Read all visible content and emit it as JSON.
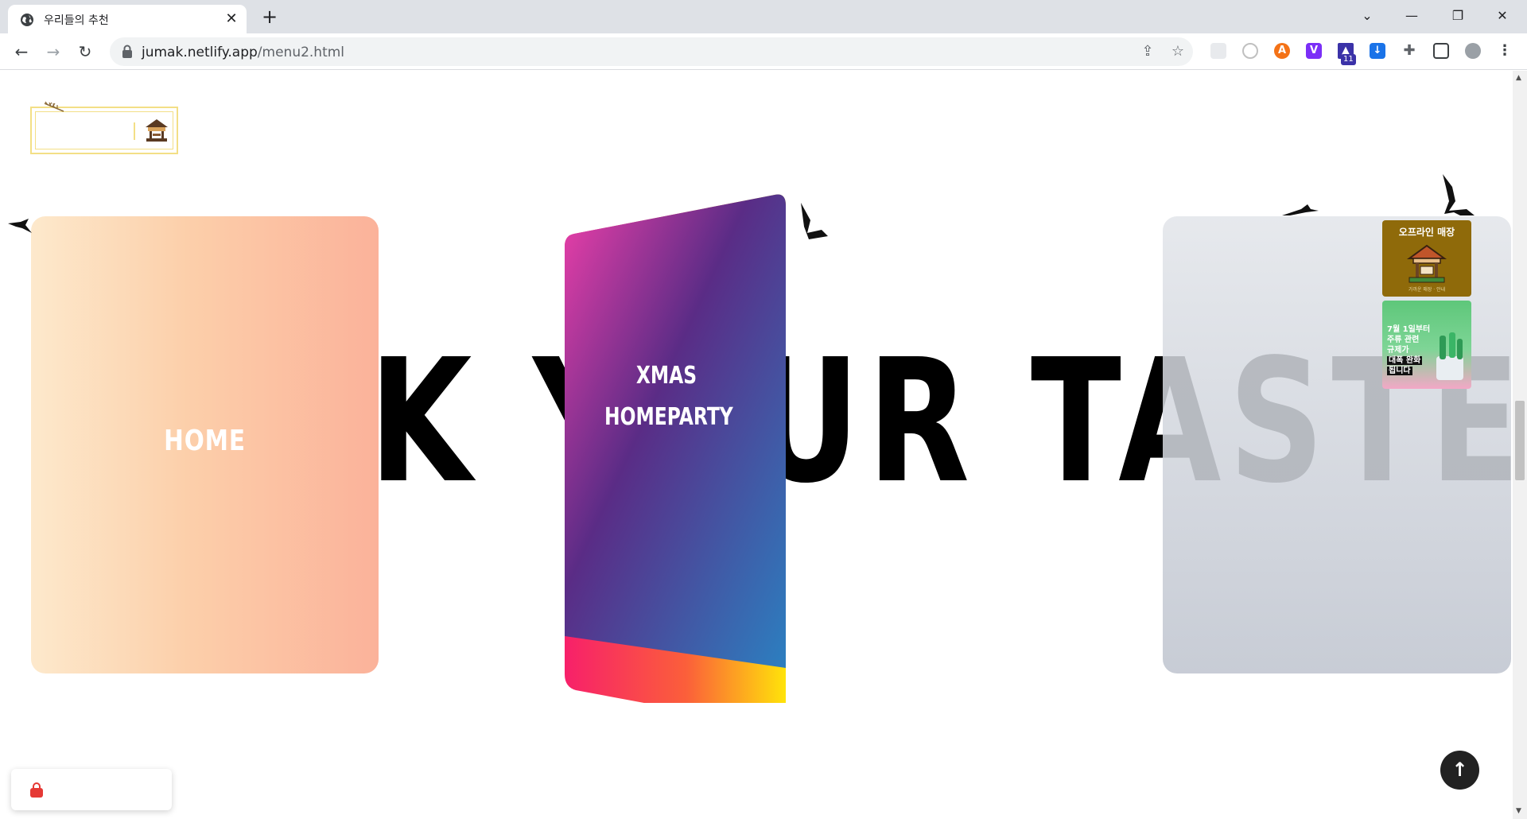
{
  "browser": {
    "tab_title": "우리들의 추천",
    "url_host": "jumak.netlify.app",
    "url_path": "/menu2.html",
    "extension_badge": "11"
  },
  "page": {
    "hero_text": "K YOUR TASTE",
    "cards": {
      "home_label": "HOME",
      "xmas_label_line1": "XMAS",
      "xmas_label_line2": "HOMEPARTY"
    },
    "side_banners": {
      "offline_store_title": "오프라인 매장",
      "offline_store_sub": "가까운 매장 · 안내",
      "promo_line1": "7월 1일부터",
      "promo_line2": "주류 관련",
      "promo_line3": "규제가",
      "promo_line4": "대폭 완화",
      "promo_line5": "됩니다"
    },
    "back_to_top_symbol": "↑"
  },
  "colors": {
    "home_card_start": "#fde9cc",
    "home_card_end": "#fbb29a",
    "xmas_top_left": "#ee3fa9",
    "xmas_mid": "#5a2c86",
    "xmas_bottom_right": "#2c7fc0",
    "logo_border": "#f3df86"
  }
}
